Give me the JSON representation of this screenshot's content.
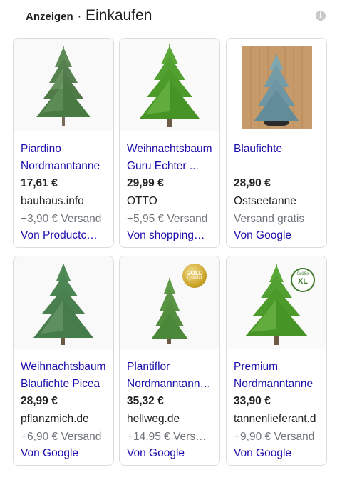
{
  "header": {
    "ads_label": "Anzeigen",
    "separator": "·",
    "title": "Einkaufen",
    "info_glyph": "i"
  },
  "products": [
    {
      "line1": "Piardino",
      "line2": "Nordmanntanne",
      "price": "17,61 €",
      "merchant": "bauhaus.info",
      "shipping": "+3,90 € Versand",
      "source": "Von Productc…",
      "image": "nordmann-tree-dark"
    },
    {
      "line1": "Weihnachtsbaum",
      "line2": "Guru Echter ...",
      "price": "29,99 €",
      "merchant": "OTTO",
      "shipping": "+5,95 € Versand",
      "source": "Von shopping…",
      "image": "nordmann-tree-bright"
    },
    {
      "line1": "Blaufichte",
      "line2": "",
      "price": "28,90 €",
      "merchant": "Ostseetanne",
      "shipping": "Versand gratis",
      "source": "Von Google",
      "image": "blue-spruce-on-wood"
    },
    {
      "line1": "Weihnachtsbaum",
      "line2": "Blaufichte Picea",
      "price": "28,99 €",
      "merchant": "pflanzmich.de",
      "shipping": "+6,90 € Versand",
      "source": "Von Google",
      "image": "blue-spruce-tree"
    },
    {
      "line1": "Plantiflor",
      "line2": "Nordmanntanne…",
      "price": "35,32 €",
      "merchant": "hellweg.de",
      "shipping": "+14,95 € Vers…",
      "source": "Von Google",
      "image": "narrow-fir-gold-badge",
      "badge": {
        "line1": "GOLD",
        "line2": "Qualität"
      }
    },
    {
      "line1": "Premium",
      "line2": "Nordmanntanne",
      "price": "33,90 €",
      "merchant": "tannenlieferant.d",
      "shipping": "+9,90 € Versand",
      "source": "Von Google",
      "image": "nordmann-tree-xl-badge",
      "badge": {
        "line1": "Größe",
        "line2": "XL"
      }
    }
  ],
  "colors": {
    "link": "#1a0dab",
    "text": "#202124",
    "muted": "#70757a",
    "border": "#dadce0",
    "tree_dark": "#4a7a44",
    "tree_bright": "#4c9a2a",
    "tree_blue": "#6e97a3",
    "gold": "#c9a227"
  }
}
